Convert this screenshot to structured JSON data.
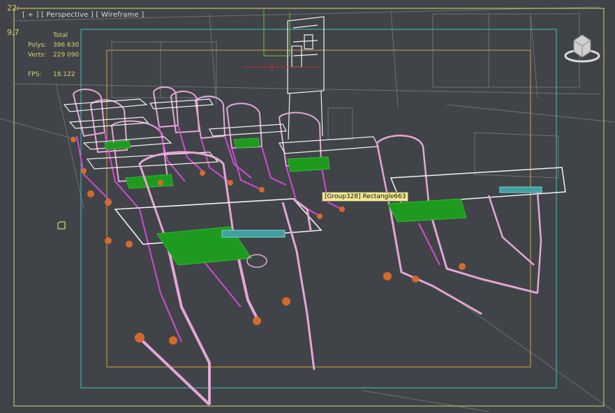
{
  "viewport": {
    "label_parts": [
      "[ + ]",
      "[ Perspective ]",
      "[ Wireframe ]"
    ],
    "edge_numbers": {
      "top": "22:",
      "side": "9,7"
    }
  },
  "stats": {
    "header": "Total",
    "polys_label": "Polys:",
    "polys_value": "396 630",
    "verts_label": "Verts:",
    "verts_value": "229 090",
    "fps_label": "FPS:",
    "fps_value": "18.122"
  },
  "tooltip": {
    "text": "[Group328] Rectangle663"
  },
  "icons": {
    "viewcube": "viewcube-icon",
    "selection": "selection-bracket-icon"
  },
  "colors": {
    "background": "#404448",
    "wire_white": "#f2f2f2",
    "wire_pink": "#e6a6d6",
    "wire_magenta": "#d44ad4",
    "seat_green": "#1e9a1e",
    "foot_orange": "#d36a2c",
    "frame_cyan": "#40c0c8",
    "frame_orange": "#d6a23c",
    "frame_yellow": "#d8d36a",
    "tooltip_bg": "#f2e88f"
  }
}
